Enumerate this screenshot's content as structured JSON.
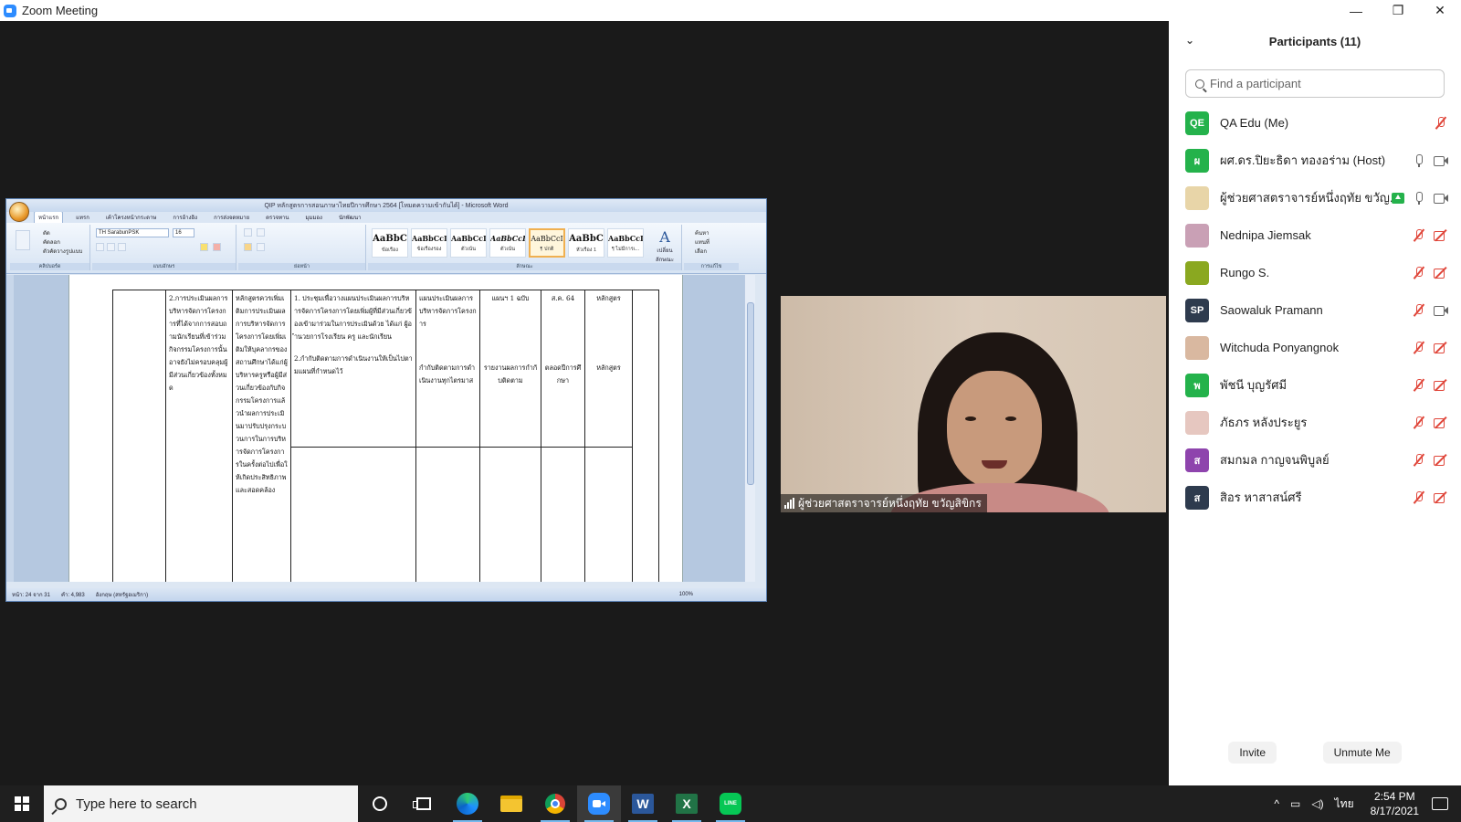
{
  "window": {
    "title": "Zoom Meeting",
    "minimize": "—",
    "maximize": "❐",
    "close": "✕"
  },
  "word": {
    "title": "QIP หลักสูตรการสอนภาษาไทยปีการศึกษา 2564 [โหมดความเข้ากันได้] - Microsoft Word",
    "tabs": [
      "หน้าแรก",
      "แทรก",
      "เค้าโครงหน้ากระดาษ",
      "การอ้างอิง",
      "การส่งจดหมาย",
      "ตรวจทาน",
      "มุมมอง",
      "นักพัฒนา"
    ],
    "font_name": "TH SarabunPSK",
    "font_size": "16",
    "ribbon_groups": [
      "คลิปบอร์ด",
      "แบบอักษร",
      "ย่อหน้า",
      "ลักษณะ",
      "การแก้ไข"
    ],
    "clipboard_labels": [
      "ตัด",
      "คัดลอก",
      "ตัวคัดวางรูปแบบ"
    ],
    "styles": [
      {
        "sample": "AaBbC",
        "name": "ข้อเรื่อง"
      },
      {
        "sample": "AaBbCcI",
        "name": "ข้อเรื่องรอง"
      },
      {
        "sample": "AaBbCcI",
        "name": "ตัวเน้น"
      },
      {
        "sample": "AaBbCcL",
        "name": "ตัวเน้น"
      },
      {
        "sample": "AaBbCcI",
        "name": "¶ ปกติ"
      },
      {
        "sample": "AaBbC",
        "name": "หัวเรื่อง 1"
      },
      {
        "sample": "AaBbCcI",
        "name": "¶ ไม่มีการเ..."
      }
    ],
    "change_styles": "เปลี่ยน ลักษณะ",
    "editing": [
      "ค้นหา",
      "แทนที่",
      "เลือก"
    ],
    "table": {
      "row1": [
        "",
        "2.การประเมินผลการบริหารจัดการโครงการที่ได้จากการสอบถามนักเรียนที่เข้าร่วมกิจกรรมโครงการนั้นอาจยังไม่ครอบคลุมผู้มีส่วนเกี่ยวข้องทั้งหมด",
        "หลักสูตรควรเพิ่มเติมการประเมินผลการบริหารจัดการโครงการโดยเพิ่มเติมให้บุคลากรของสถานศึกษาได้แก่ผู้บริหารครูหรือผู้มีส่วนเกี่ยวข้องกับกิจกรรมโครงการแล้วนำผลการประเมินมาปรับปรุงกระบวนการในการบริหารจัดการโครงการในครั้งต่อไปเพื่อให้เกิดประสิทธิภาพและสอดคล้อง",
        "1. ประชุมเพื่อวางแผนประเมินผลการบริหารจัดการโครงการโดยเพิ่มผู้ที่มีส่วนเกี่ยวข้องเข้ามาร่วมในการประเมินด้วย ได้แก่ ผู้อำนวยการโรงเรียน ครู และนักเรียน",
        "แผนประเมินผลการบริหารจัดการโครงการ",
        "แผนฯ 1 ฉบับ",
        "ส.ค. 64",
        "หลักสูตร",
        ""
      ],
      "row1b": [
        "2.กำกับติดตามการดำเนินงานให้เป็นไปตามแผนที่กำหนดไว้",
        "กำกับติดตามการดำเนินงานทุกไตรมาส",
        "รายงานผลการกำกับติดตาม",
        "ตลอดปีการศึกษา",
        "หลักสูตร"
      ]
    },
    "status": [
      "หน้า: 24 จาก 31",
      "คำ: 4,983",
      "อังกฤษ (สหรัฐอเมริกา)",
      "100%"
    ]
  },
  "video": {
    "name": "ผู้ช่วยศาสตราจารย์หนึ่งฤทัย ขวัญสิขิกร"
  },
  "panel": {
    "title": "Participants (11)",
    "search_placeholder": "Find a participant",
    "participants": [
      {
        "name": "QA Edu (Me)",
        "initials": "QE",
        "color": "#24b24b",
        "mic": "muted",
        "video": "none"
      },
      {
        "name": "ผศ.ดร.ปิยะธิดา ทองอร่าม (Host)",
        "initials": "ผ",
        "color": "#24b24b",
        "mic": "on",
        "video": "on"
      },
      {
        "name": "ผู้ช่วยศาสตราจารย์หนึ่งฤทัย ขวัญ...",
        "initials": "",
        "color": "#e8d5a8",
        "mic": "on",
        "video": "on",
        "sharing": true
      },
      {
        "name": "Nednipa Jiemsak",
        "initials": "",
        "color": "#c9a0b5",
        "mic": "muted",
        "video": "off"
      },
      {
        "name": "Rungo S.",
        "initials": "",
        "color": "#8aa820",
        "mic": "muted",
        "video": "off"
      },
      {
        "name": "Saowaluk Pramann",
        "initials": "SP",
        "color": "#2e3b4e",
        "mic": "muted",
        "video": "on"
      },
      {
        "name": "Witchuda Ponyangnok",
        "initials": "",
        "color": "#d9b8a0",
        "mic": "muted",
        "video": "off"
      },
      {
        "name": "พัชนี บุญรัศมี",
        "initials": "พ",
        "color": "#24b24b",
        "mic": "muted",
        "video": "off"
      },
      {
        "name": "ภัธภร หลังประยูร",
        "initials": "",
        "color": "#e6c7c0",
        "mic": "muted",
        "video": "off"
      },
      {
        "name": "สมกมล กาญจนพิบูลย์",
        "initials": "ส",
        "color": "#8e44ad",
        "mic": "muted",
        "video": "off"
      },
      {
        "name": "สิอร หาสาสน์ศรี",
        "initials": "ส",
        "color": "#2e3b4e",
        "mic": "muted",
        "video": "off"
      }
    ],
    "invite": "Invite",
    "unmute": "Unmute Me"
  },
  "taskbar": {
    "search_text": "Type here to search",
    "lang": "ไทย",
    "time": "2:54 PM",
    "date": "8/17/2021"
  }
}
